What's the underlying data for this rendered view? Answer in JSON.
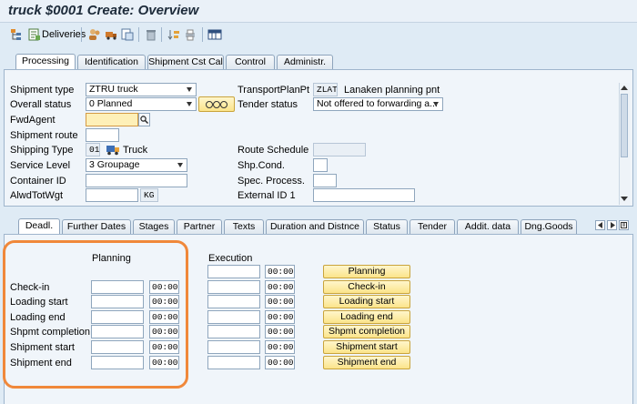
{
  "window": {
    "title": "truck $0001 Create: Overview"
  },
  "toolbar": {
    "deliveries_label": "Deliveries"
  },
  "header_tabs": [
    "Processing",
    "Identification",
    "Shipment Cst Cal",
    "Control",
    "Administr."
  ],
  "processing": {
    "shipment_type": {
      "label": "Shipment type",
      "value": "ZTRU truck"
    },
    "overall_status": {
      "label": "Overall status",
      "value": "0 Planned"
    },
    "fwd_agent": {
      "label": "FwdAgent",
      "value": ""
    },
    "shipment_route": {
      "label": "Shipment route",
      "value": ""
    },
    "shipping_type": {
      "label": "Shipping Type",
      "code": "01",
      "text": "Truck"
    },
    "service_level": {
      "label": "Service Level",
      "value": "3 Groupage"
    },
    "container_id": {
      "label": "Container ID",
      "value": ""
    },
    "alwd_tot_wgt": {
      "label": "AlwdTotWgt",
      "value": "",
      "unit": "KG"
    },
    "transport_plan_pt": {
      "label": "TransportPlanPt",
      "code": "ZLAT",
      "text": "Lanaken planning pnt"
    },
    "tender_status": {
      "label": "Tender status",
      "value": "Not offered to forwarding a..."
    },
    "route_schedule": {
      "label": "Route Schedule",
      "value": ""
    },
    "shp_cond": {
      "label": "Shp.Cond.",
      "value": ""
    },
    "spec_process": {
      "label": "Spec. Process.",
      "value": ""
    },
    "external_id": {
      "label": "External ID 1",
      "value": ""
    }
  },
  "detail_tabs": [
    "Deadl.",
    "Further Dates",
    "Stages",
    "Partner",
    "Texts",
    "Duration and Distnce",
    "Status",
    "Tender",
    "Addit. data",
    "Dng.Goods"
  ],
  "deadlines": {
    "planning_header": "Planning",
    "execution_header": "Execution",
    "default_time": "00:00",
    "rows": [
      "Check-in",
      "Loading start",
      "Loading end",
      "Shpmt completion",
      "Shipment start",
      "Shipment end"
    ],
    "buttons": [
      "Planning",
      "Check-in",
      "Loading start",
      "Loading end",
      "Shpmt completion",
      "Shipment start",
      "Shipment end"
    ]
  },
  "colors": {
    "highlight_ring": "#f0883a",
    "required_field": "#fef0b8",
    "action_button": "#fbe48a"
  }
}
